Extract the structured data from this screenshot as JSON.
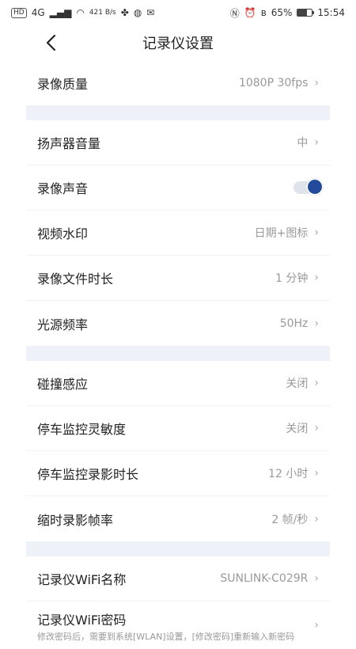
{
  "status_bar": {
    "network_speed": "421 B/s",
    "carrier_badge": "HD",
    "signal_label": "4G",
    "battery_percent": "65%",
    "time": "15:54"
  },
  "header": {
    "title": "记录仪设置"
  },
  "settings": {
    "record_quality": {
      "label": "录像质量",
      "value": "1080P 30fps"
    },
    "speaker_volume": {
      "label": "扬声器音量",
      "value": "中"
    },
    "record_sound": {
      "label": "录像声音",
      "enabled": true
    },
    "video_watermark": {
      "label": "视频水印",
      "value": "日期+图标"
    },
    "record_duration": {
      "label": "录像文件时长",
      "value": "1 分钟"
    },
    "light_frequency": {
      "label": "光源频率",
      "value": "50Hz"
    },
    "collision_sense": {
      "label": "碰撞感应",
      "value": "关闭"
    },
    "parking_sensitivity": {
      "label": "停车监控灵敏度",
      "value": "关闭"
    },
    "parking_duration": {
      "label": "停车监控录影时长",
      "value": "12 小时"
    },
    "timelapse_rate": {
      "label": "缩时录影帧率",
      "value": "2 帧/秒"
    },
    "wifi_name": {
      "label": "记录仪WiFi名称",
      "value": "SUNLINK-C029R"
    },
    "wifi_password": {
      "label": "记录仪WiFi密码",
      "hint": "修改密码后，需要到系统[WLAN]设置，[修改密码]重新输入新密码"
    }
  },
  "colors": {
    "accent": "#244b9b",
    "section_gap": "#eef2f8"
  }
}
